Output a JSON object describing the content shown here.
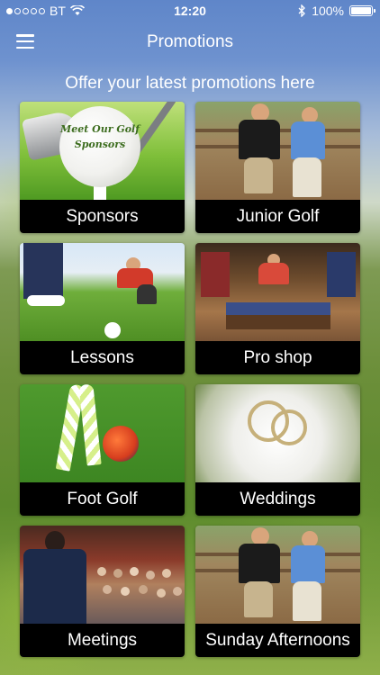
{
  "status_bar": {
    "carrier": "BT",
    "time": "12:20",
    "battery": "100%",
    "battery_level": 1.0,
    "signal_bars_filled": 1,
    "signal_bars_total": 5
  },
  "navbar": {
    "title": "Promotions",
    "menu_icon": "hamburger-menu-icon"
  },
  "subtitle": "Offer your latest promotions here",
  "tiles": [
    {
      "label": "Sponsors",
      "image_text": "Meet Our Golf Sponsors"
    },
    {
      "label": "Junior Golf"
    },
    {
      "label": "Lessons"
    },
    {
      "label": "Pro shop"
    },
    {
      "label": "Foot Golf"
    },
    {
      "label": "Weddings"
    },
    {
      "label": "Meetings"
    },
    {
      "label": "Sunday Afternoons"
    }
  ],
  "colors": {
    "tile_label_bg": "#000000",
    "text": "#ffffff",
    "sky_blue": "#5f86c9",
    "grass_green": "#5c8a2c"
  }
}
